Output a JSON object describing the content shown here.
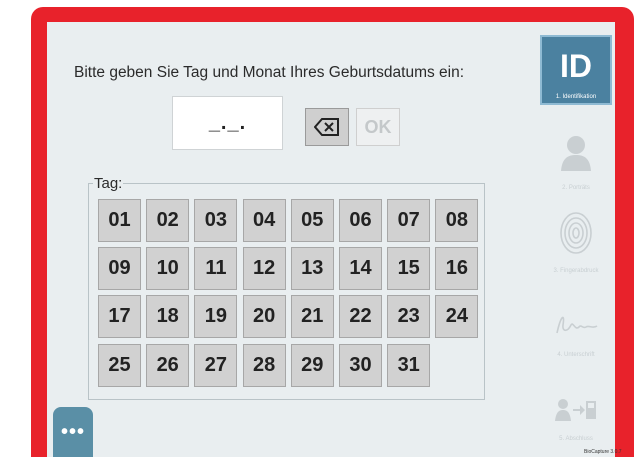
{
  "prompt": "Bitte geben Sie Tag und Monat Ihres Geburtsdatums ein:",
  "date_field": {
    "value": "_._."
  },
  "buttons": {
    "ok_label": "OK",
    "backspace_icon": "backspace-icon",
    "more_label": "•••"
  },
  "day_group": {
    "legend": "Tag:",
    "days": [
      "01",
      "02",
      "03",
      "04",
      "05",
      "06",
      "07",
      "08",
      "09",
      "10",
      "11",
      "12",
      "13",
      "14",
      "15",
      "16",
      "17",
      "18",
      "19",
      "20",
      "21",
      "22",
      "23",
      "24",
      "25",
      "26",
      "27",
      "28",
      "29",
      "30",
      "31"
    ]
  },
  "steps": [
    {
      "badge": "ID",
      "label": "1. Identifikation",
      "icon": "id-icon",
      "active": true
    },
    {
      "label": "2. Porträts",
      "icon": "person-icon",
      "active": false
    },
    {
      "label": "3. Fingerabdruck",
      "icon": "fingerprint-icon",
      "active": false
    },
    {
      "label": "4. Unterschrift",
      "icon": "signature-icon",
      "active": false
    },
    {
      "label": "5. Abschluss",
      "icon": "transfer-icon",
      "active": false
    }
  ],
  "version": "BioCapture 3.0.7",
  "colors": {
    "frame": "#e8222b",
    "accent": "#4b81a0",
    "background": "#e9eef0"
  }
}
